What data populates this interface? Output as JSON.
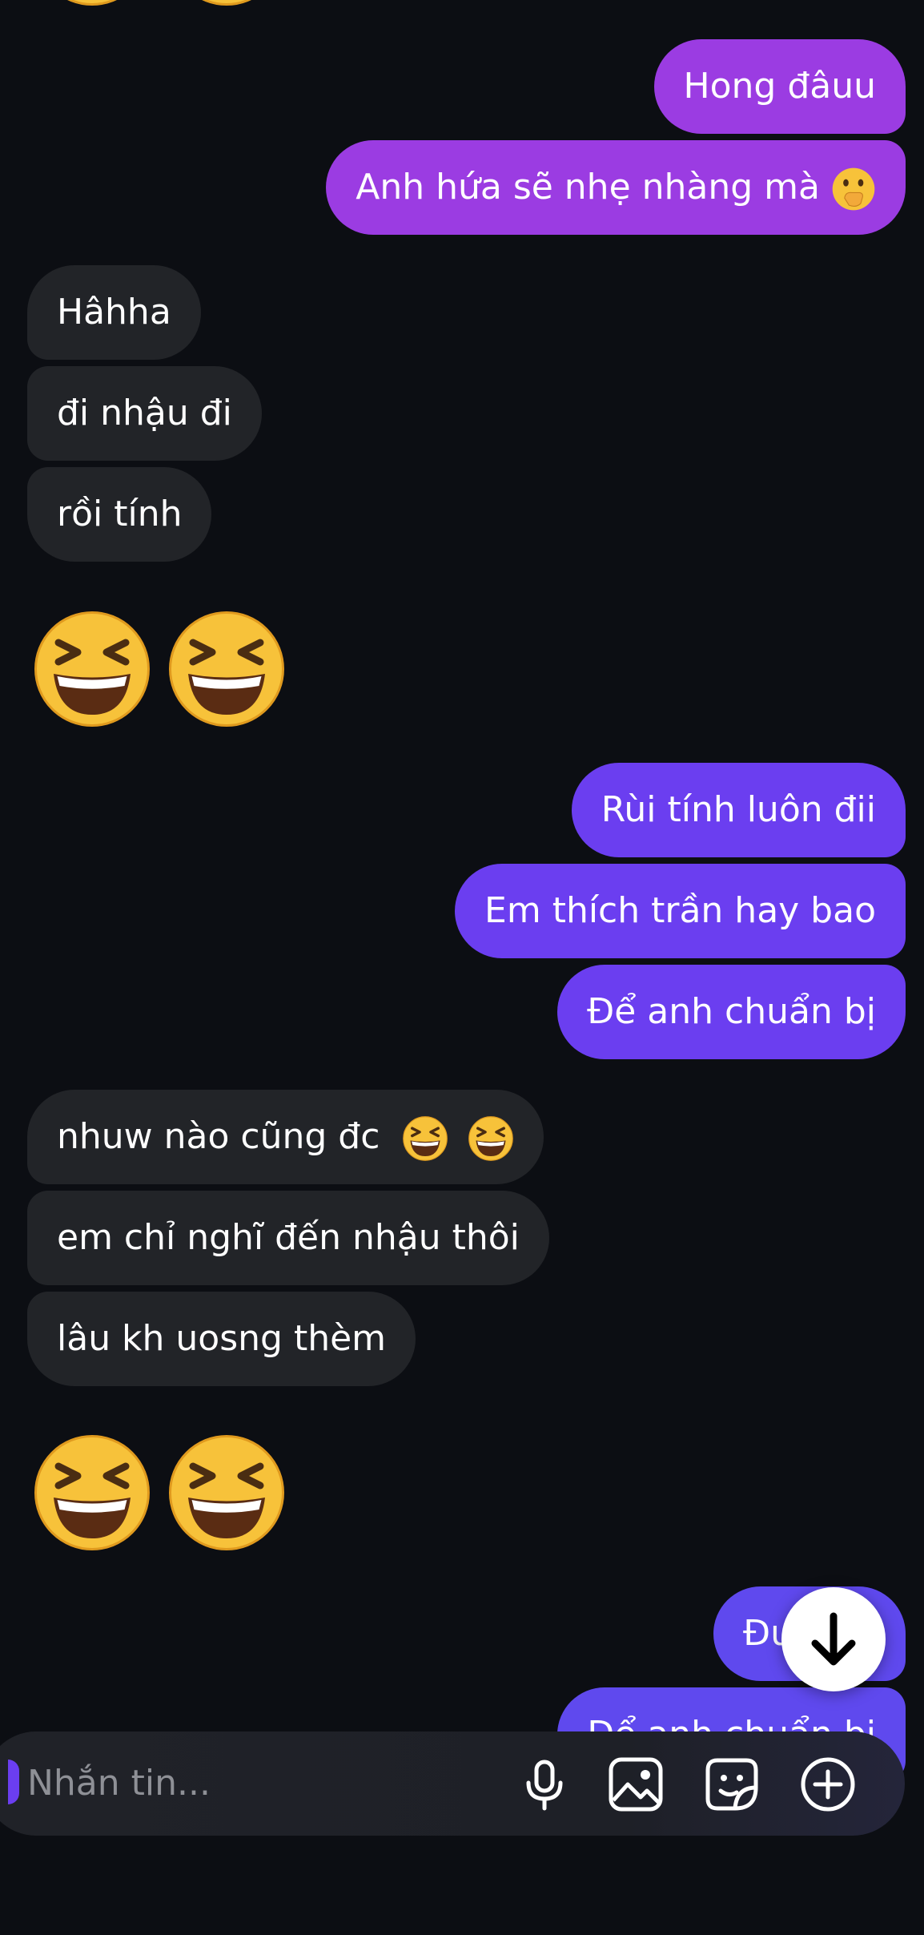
{
  "messages": {
    "m1": "Hong đâuu",
    "m2": "Anh hứa sẽ nhẹ nhàng mà",
    "m3": "Hâhha",
    "m4": "đi nhậu đi",
    "m5": "rồi tính",
    "m6": "Rùi tính luôn đii",
    "m7": "Em thích trần hay bao",
    "m8": "Để anh chuẩn bị",
    "m9": "nhuw nào cũng đc",
    "m10": "em chỉ nghĩ đến nhậu thôi",
    "m11": "lâu kh uosng thèm",
    "m12": "Đư",
    "m13": "Để anh chuẩn bị"
  },
  "emoji": {
    "m2_trailing": "face-with-hand-over-mouth",
    "m9_trailing": "grinning-squinting-face",
    "big": "grinning-squinting-face"
  },
  "composer": {
    "placeholder": "Nhắn tin..."
  },
  "icons": {
    "mic": "mic-icon",
    "image": "image-icon",
    "sticker": "sticker-icon",
    "add": "plus-circle-icon",
    "scroll_down": "arrow-down-icon"
  },
  "colors": {
    "background": "#0c0e13",
    "incoming_bubble": "#222428",
    "outgoing_purple": "#9b3ce2",
    "outgoing_violet": "#6b3ef0",
    "outgoing_indigo": "#5f49ee",
    "placeholder_text": "#8e9096"
  }
}
